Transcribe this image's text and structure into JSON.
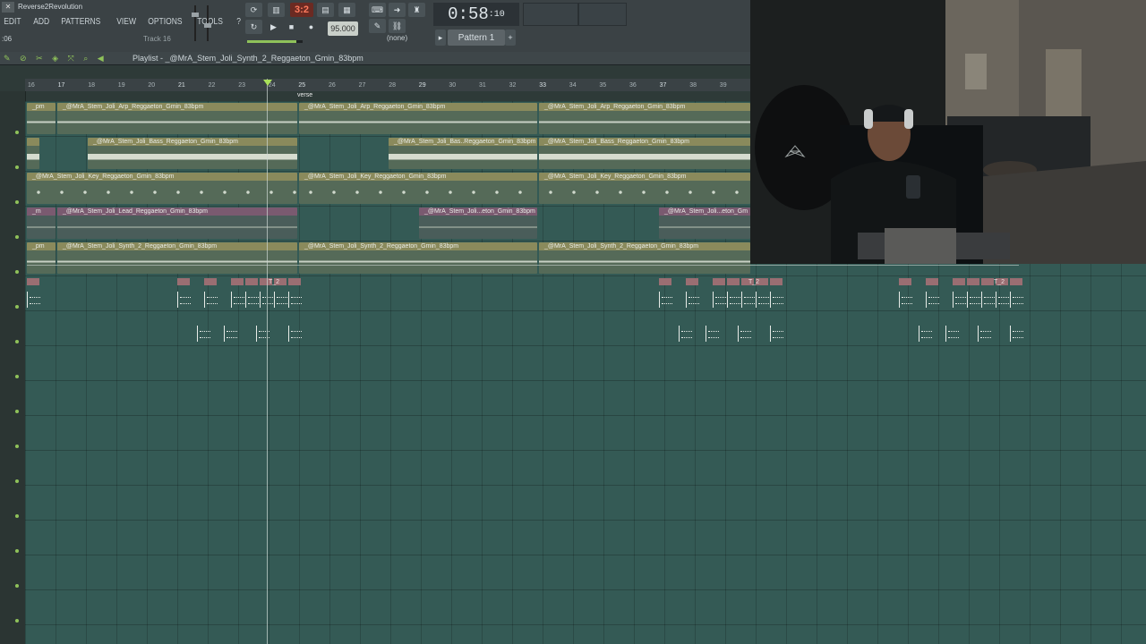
{
  "app": {
    "title": "Reverse2Revolution",
    "menu": [
      "EDIT",
      "ADD",
      "PATTERNS",
      "VIEW",
      "OPTIONS",
      "TOOLS",
      "?"
    ],
    "track_label": "Track 16",
    "time_readout": ":06"
  },
  "transport": {
    "pattern_counter": "3:2",
    "tempo": "95.000",
    "clock": "0:58",
    "clock_frames": "10",
    "snap": "(none)",
    "pattern": "Pattern 1"
  },
  "playlist": {
    "title": "Playlist - _@MrA_Stem_Joli_Synth_2_Reggaeton_Gmin_83bpm",
    "marker": "verse",
    "ruler": [
      "16",
      "17",
      "18",
      "19",
      "20",
      "21",
      "22",
      "23",
      "24",
      "25",
      "26",
      "27",
      "28",
      "29",
      "30",
      "31",
      "32",
      "33",
      "34",
      "35",
      "36",
      "37",
      "38",
      "39"
    ]
  },
  "clips": {
    "arp": "_@MrA_Stem_Joli_Arp_Reggaeton_Gmin_83bpm",
    "arp_short": "_pm",
    "bass": "_@MrA_Stem_Joli_Bass_Reggaeton_Gmin_83bpm",
    "bass_alt": "_@MrA_Stem_Joli_Bas..Reggaeton_Gmin_83bpm",
    "key": "_@MrA_Stem_Joli_Key_Reggaeton_Gmin_83bpm",
    "lead": "_@MrA_Stem_Joli_Lead_Reggaeton_Gmin_83bpm",
    "lead_short": "_m",
    "lead_mid": "_@MrA_Stem_Joli...eton_Gmin_83bpm",
    "lead_end": "_@MrA_Stem_Joli...eton_Gm",
    "synth": "_@MrA_Stem_Joli_Synth_2_Reggaeton_Gmin_83bpm",
    "drum_tag": "T_2"
  },
  "colors": {
    "grid": "#345a55",
    "clip_tan": "#8a8a5c",
    "clip_purple": "#7a5a70",
    "clip_pink": "#9a6e72",
    "accent_orange": "#ff7b5e"
  }
}
